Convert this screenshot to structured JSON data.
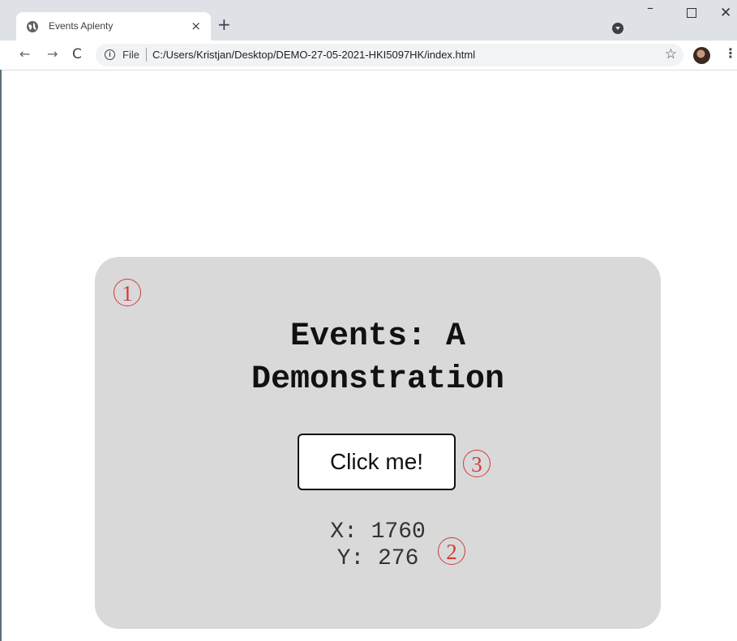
{
  "browser": {
    "tab_title": "Events Aplenty",
    "tab_close": "×",
    "new_tab": "+",
    "address": {
      "scheme_label": "File",
      "url": "C:/Users/Kristjan/Desktop/DEMO-27-05-2021-HKI5097HK/index.html"
    },
    "icons": {
      "back": "←",
      "forward": "→",
      "reload": "C",
      "info": "i",
      "star": "☆",
      "menu": "⋮",
      "minimize": "–",
      "close": "✕"
    }
  },
  "page": {
    "heading_line1": "Events: A",
    "heading_line2": "Demonstration",
    "button_label": "Click me!",
    "coord_x_label": "X: 1760",
    "coord_y_label": "Y: 276"
  },
  "annotations": {
    "marker1": "1",
    "marker2": "2",
    "marker3": "3",
    "color": "#d23b3b"
  },
  "colors": {
    "card_background": "#d9d9d9",
    "tabstrip": "#dee1e6"
  }
}
